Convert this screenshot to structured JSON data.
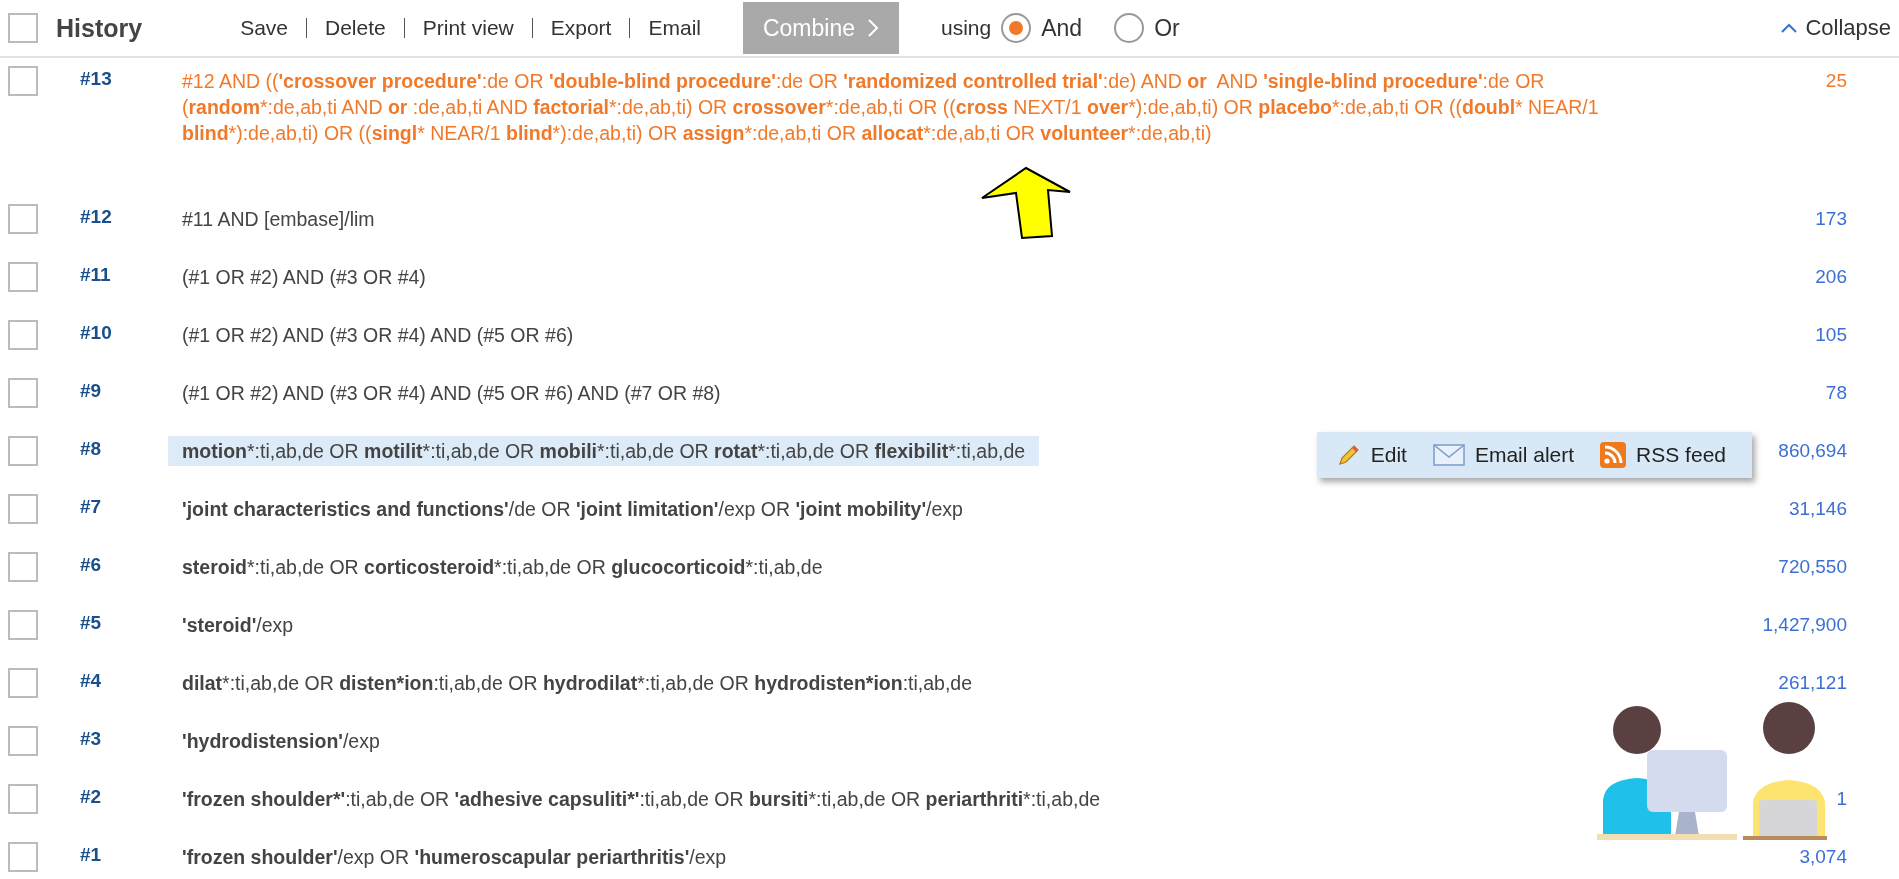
{
  "header": {
    "title": "History",
    "checked": false,
    "actions": [
      "Save",
      "Delete",
      "Print view",
      "Export",
      "Email"
    ],
    "combine": {
      "label": "Combine",
      "disabled": true
    },
    "using_label": "using",
    "options": [
      {
        "label": "And",
        "selected": true
      },
      {
        "label": "Or",
        "selected": false
      }
    ],
    "collapse": "Collapse"
  },
  "rows": [
    {
      "number": "#13",
      "kind": "latest",
      "checked": false,
      "hovered": false,
      "count": "25",
      "query": [
        {
          "text": "#12 AND ((",
          "bold": false
        },
        {
          "text": "'crossover procedure'",
          "bold": true
        },
        {
          "text": ":de OR ",
          "bold": false
        },
        {
          "text": "'double-blind procedure'",
          "bold": true
        },
        {
          "text": ":de OR ",
          "bold": false
        },
        {
          "text": "'randomized controlled trial'",
          "bold": true
        },
        {
          "text": ":de) AND ",
          "bold": false
        },
        {
          "text": "or",
          "bold": true
        },
        {
          "text": "  AND ",
          "bold": false
        },
        {
          "text": "'single-blind procedure'",
          "bold": true
        },
        {
          "text": ":de OR (",
          "bold": false
        },
        {
          "text": "random",
          "bold": true
        },
        {
          "text": "*:de,ab,ti AND ",
          "bold": false
        },
        {
          "text": "or",
          "bold": true
        },
        {
          "text": " :de,ab,ti AND ",
          "bold": false
        },
        {
          "text": "factorial",
          "bold": true
        },
        {
          "text": "*:de,ab,ti) OR ",
          "bold": false
        },
        {
          "text": "crossover",
          "bold": true
        },
        {
          "text": "*:de,ab,ti OR ((",
          "bold": false
        },
        {
          "text": "cross",
          "bold": true
        },
        {
          "text": " NEXT/1 ",
          "bold": false
        },
        {
          "text": "over",
          "bold": true
        },
        {
          "text": "*):de,ab,ti) OR ",
          "bold": false
        },
        {
          "text": "placebo",
          "bold": true
        },
        {
          "text": "*:de,ab,ti OR ((",
          "bold": false
        },
        {
          "text": "doubl",
          "bold": true
        },
        {
          "text": "* NEAR/1 ",
          "bold": false
        },
        {
          "text": "blind",
          "bold": true
        },
        {
          "text": "*):de,ab,ti) OR ((",
          "bold": false
        },
        {
          "text": "singl",
          "bold": true
        },
        {
          "text": "* NEAR/1 ",
          "bold": false
        },
        {
          "text": "blind",
          "bold": true
        },
        {
          "text": "*):de,ab,ti) OR ",
          "bold": false
        },
        {
          "text": "assign",
          "bold": true
        },
        {
          "text": "*:de,ab,ti OR ",
          "bold": false
        },
        {
          "text": "allocat",
          "bold": true
        },
        {
          "text": "*:de,ab,ti OR ",
          "bold": false
        },
        {
          "text": "volunteer",
          "bold": true
        },
        {
          "text": "*:de,ab,ti)",
          "bold": false
        }
      ]
    },
    {
      "number": "#12",
      "kind": "normal",
      "checked": false,
      "hovered": false,
      "count": "173",
      "query": [
        {
          "text": "#11 AND [embase]/lim",
          "bold": false
        }
      ]
    },
    {
      "number": "#11",
      "kind": "normal",
      "checked": false,
      "hovered": false,
      "count": "206",
      "query": [
        {
          "text": "(#1 OR #2) AND (#3 OR #4)",
          "bold": false
        }
      ]
    },
    {
      "number": "#10",
      "kind": "normal",
      "checked": false,
      "hovered": false,
      "count": "105",
      "query": [
        {
          "text": "(#1 OR #2) AND (#3 OR #4) AND (#5 OR #6)",
          "bold": false
        }
      ]
    },
    {
      "number": "#9",
      "kind": "normal",
      "checked": false,
      "hovered": false,
      "count": "78",
      "query": [
        {
          "text": "(#1 OR #2) AND (#3 OR #4) AND (#5 OR #6) AND (#7 OR #8)",
          "bold": false
        }
      ]
    },
    {
      "number": "#8",
      "kind": "normal",
      "checked": false,
      "hovered": true,
      "count": "860,694",
      "query": [
        {
          "text": "motion",
          "bold": true
        },
        {
          "text": "*:ti,ab,de OR ",
          "bold": false
        },
        {
          "text": "motilit",
          "bold": true
        },
        {
          "text": "*:ti,ab,de OR ",
          "bold": false
        },
        {
          "text": "mobili",
          "bold": true
        },
        {
          "text": "*:ti,ab,de OR ",
          "bold": false
        },
        {
          "text": "rotat",
          "bold": true
        },
        {
          "text": "*:ti,ab,de OR ",
          "bold": false
        },
        {
          "text": "flexibilit",
          "bold": true
        },
        {
          "text": "*:ti,ab,de",
          "bold": false
        }
      ]
    },
    {
      "number": "#7",
      "kind": "normal",
      "checked": false,
      "hovered": false,
      "count": "31,146",
      "query": [
        {
          "text": "'joint characteristics and functions'",
          "bold": true
        },
        {
          "text": "/de OR ",
          "bold": false
        },
        {
          "text": "'joint limitation'",
          "bold": true
        },
        {
          "text": "/exp OR ",
          "bold": false
        },
        {
          "text": "'joint mobility'",
          "bold": true
        },
        {
          "text": "/exp",
          "bold": false
        }
      ]
    },
    {
      "number": "#6",
      "kind": "normal",
      "checked": false,
      "hovered": false,
      "count": "720,550",
      "query": [
        {
          "text": "steroid",
          "bold": true
        },
        {
          "text": "*:ti,ab,de OR ",
          "bold": false
        },
        {
          "text": "corticosteroid",
          "bold": true
        },
        {
          "text": "*:ti,ab,de OR ",
          "bold": false
        },
        {
          "text": "glucocorticoid",
          "bold": true
        },
        {
          "text": "*:ti,ab,de",
          "bold": false
        }
      ]
    },
    {
      "number": "#5",
      "kind": "normal",
      "checked": false,
      "hovered": false,
      "count": "1,427,900",
      "query": [
        {
          "text": "'steroid'",
          "bold": true
        },
        {
          "text": "/exp",
          "bold": false
        }
      ]
    },
    {
      "number": "#4",
      "kind": "normal",
      "checked": false,
      "hovered": false,
      "count": "261,121",
      "query": [
        {
          "text": "dilat",
          "bold": true
        },
        {
          "text": "*:ti,ab,de OR ",
          "bold": false
        },
        {
          "text": "disten*ion",
          "bold": true
        },
        {
          "text": ":ti,ab,de OR ",
          "bold": false
        },
        {
          "text": "hydrodilat",
          "bold": true
        },
        {
          "text": "*:ti,ab,de OR ",
          "bold": false
        },
        {
          "text": "hydrodisten*ion",
          "bold": true
        },
        {
          "text": ":ti,ab,de",
          "bold": false
        }
      ]
    },
    {
      "number": "#3",
      "kind": "normal",
      "checked": false,
      "hovered": false,
      "query": [
        {
          "text": "'hydrodistension'",
          "bold": true
        },
        {
          "text": "/exp",
          "bold": false
        }
      ]
    },
    {
      "number": "#2",
      "kind": "normal",
      "checked": false,
      "hovered": false,
      "count": "1",
      "query": [
        {
          "text": "'frozen shoulder*'",
          "bold": true
        },
        {
          "text": ":ti,ab,de OR ",
          "bold": false
        },
        {
          "text": "'adhesive capsuliti*'",
          "bold": true
        },
        {
          "text": ":ti,ab,de OR ",
          "bold": false
        },
        {
          "text": "bursiti",
          "bold": true
        },
        {
          "text": "*:ti,ab,de OR ",
          "bold": false
        },
        {
          "text": "periarthriti",
          "bold": true
        },
        {
          "text": "*:ti,ab,de",
          "bold": false
        }
      ]
    },
    {
      "number": "#1",
      "kind": "normal",
      "checked": false,
      "hovered": false,
      "count": "3,074",
      "query": [
        {
          "text": "'frozen shoulder'",
          "bold": true
        },
        {
          "text": "/exp OR ",
          "bold": false
        },
        {
          "text": "'humeroscapular periarthritis'",
          "bold": true
        },
        {
          "text": "/exp",
          "bold": false
        }
      ]
    }
  ],
  "row_menu": [
    {
      "kind": "edit",
      "label": "Edit"
    },
    {
      "kind": "email",
      "label": "Email alert"
    },
    {
      "kind": "rss",
      "label": "RSS feed"
    }
  ]
}
